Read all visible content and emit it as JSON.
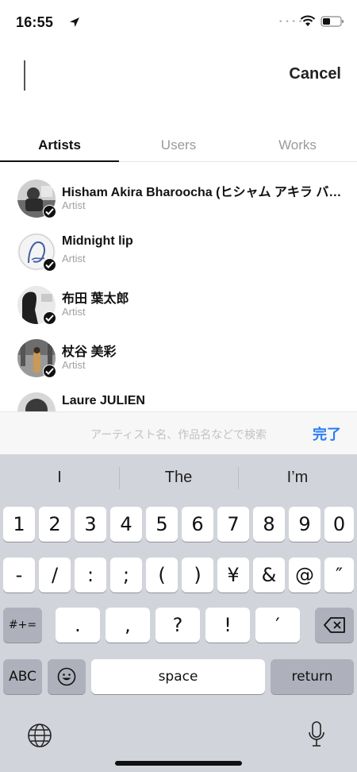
{
  "status_bar": {
    "time": "16:55"
  },
  "search": {
    "cancel_label": "Cancel"
  },
  "tabs": [
    {
      "label": "Artists",
      "active": true
    },
    {
      "label": "Users",
      "active": false
    },
    {
      "label": "Works",
      "active": false
    }
  ],
  "results": [
    {
      "name": "Hisham Akira Bharoocha (ヒシャム アキラ バル…",
      "sub": "Artist"
    },
    {
      "name": "Midnight lip",
      "sub": "Artist"
    },
    {
      "name": "布田 葉太郎",
      "sub": "Artist"
    },
    {
      "name": "杖谷 美彩",
      "sub": "Artist"
    },
    {
      "name": "Laure JULIEN",
      "sub": ""
    }
  ],
  "accessory": {
    "hint": "アーティスト名、作品名などで検索",
    "done_label": "完了"
  },
  "keyboard": {
    "predictions": [
      "I",
      "The",
      "I’m"
    ],
    "row1": [
      "1",
      "2",
      "3",
      "4",
      "5",
      "6",
      "7",
      "8",
      "9",
      "0"
    ],
    "row2": [
      "-",
      "/",
      ":",
      ";",
      "(",
      ")",
      "¥",
      "&",
      "@",
      "″"
    ],
    "row3": [
      ".",
      ",",
      "?",
      "!",
      "′"
    ],
    "symbols_label": "#+=",
    "abc_label": "ABC",
    "space_label": "space",
    "return_label": "return"
  },
  "colors": {
    "accent": "#2a7cf6",
    "keyboard_bg": "#d2d4db"
  }
}
